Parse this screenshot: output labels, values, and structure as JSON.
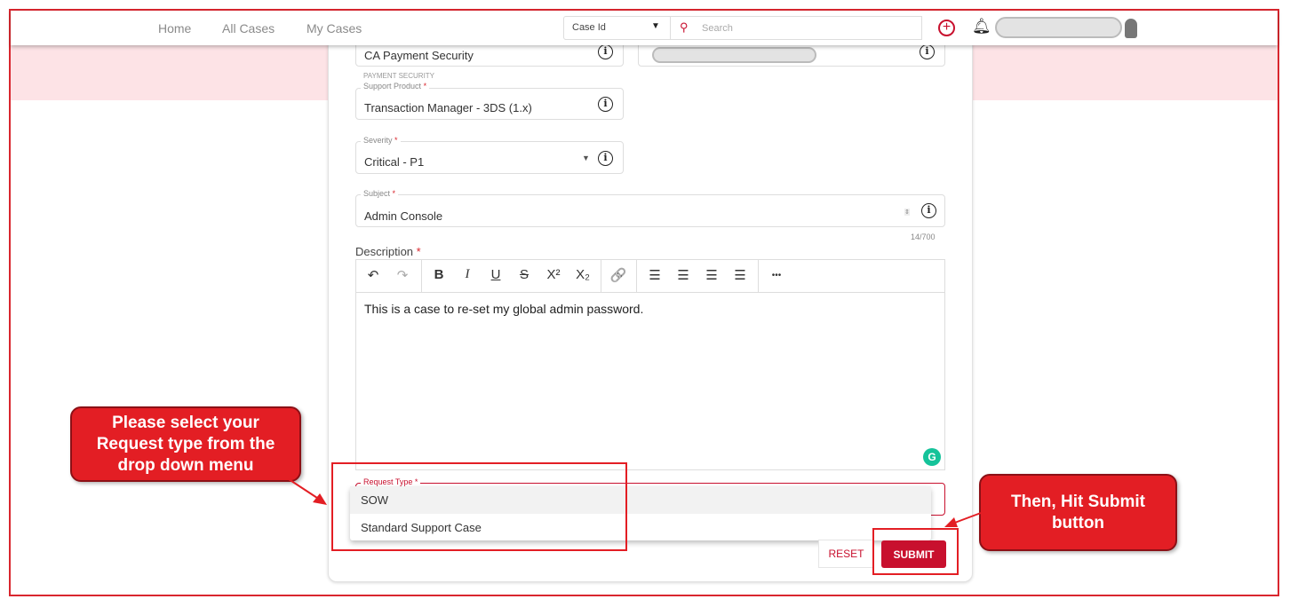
{
  "nav": {
    "links": [
      "Home",
      "All Cases",
      "My Cases"
    ],
    "search_type": "Case Id",
    "search_placeholder": "Search"
  },
  "form": {
    "product_line": "CA Payment Security",
    "support_product_group": "PAYMENT SECURITY",
    "support_product_label": "Support Product",
    "support_product": "Transaction Manager - 3DS (1.x)",
    "severity_label": "Severity",
    "severity": "Critical - P1",
    "subject_label": "Subject",
    "subject": "Admin Console",
    "subject_count": "14/700",
    "description_label": "Description",
    "description": "This is a case to re-set my global admin password.",
    "request_type_label": "Request Type",
    "request_type_options": [
      "SOW",
      "Standard Support Case"
    ],
    "reset": "RESET",
    "submit": "SUBMIT",
    "required": "*"
  },
  "toolbar": {
    "undo": "↶",
    "redo": "↷",
    "bold": "B",
    "italic": "I",
    "underline": "U",
    "strike": "S",
    "sup": "X²",
    "sub": "X₂",
    "link": "🔗",
    "more": "•••"
  },
  "callouts": {
    "left": "Please select your Request type from the drop down menu",
    "right": "Then, Hit Submit button"
  },
  "colors": {
    "accent": "#c8102e",
    "callout": "#e31e24"
  }
}
